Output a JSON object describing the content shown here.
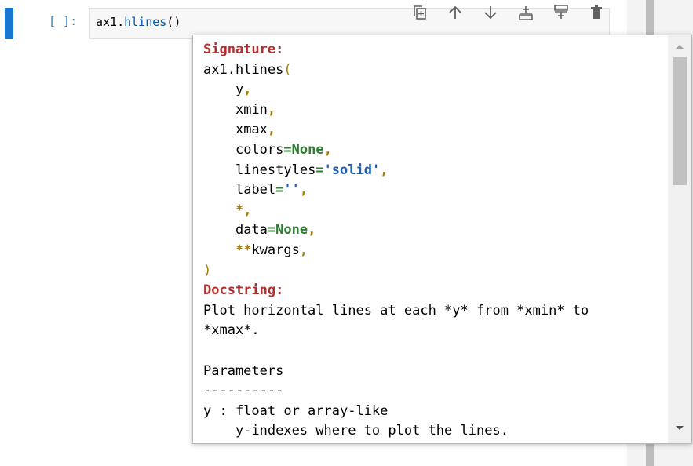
{
  "cell": {
    "prompt": "[ ]:",
    "code_obj": "ax1",
    "code_dot": ".",
    "code_attr": "hlines",
    "code_parens": "()"
  },
  "toolbar": {
    "buttons": [
      "duplicate-cell-icon",
      "move-up-icon",
      "move-down-icon",
      "insert-above-icon",
      "insert-below-icon",
      "delete-icon"
    ]
  },
  "tooltip": {
    "signature_header": "Signature:",
    "call": "ax1.hlines",
    "open_paren": "(",
    "params": {
      "y": "y",
      "xmin": "xmin",
      "xmax": "xmax",
      "colors_name": "colors",
      "colors_default": "None",
      "linestyles_name": "linestyles",
      "linestyles_default": "'solid'",
      "label_name": "label",
      "label_default": "''",
      "star": "*",
      "data_name": "data",
      "data_default": "None",
      "kwargs_stars": "**",
      "kwargs_name": "kwargs"
    },
    "close_paren": ")",
    "docstring_header": "Docstring:",
    "doc_lines": [
      "Plot horizontal lines at each *y* from *xmin* to",
      "*xmax*.",
      "",
      "Parameters",
      "----------",
      "y : float or array-like",
      "    y-indexes where to plot the lines."
    ]
  },
  "colors": {
    "cell_bar": "#1976d2",
    "header_red": "#b22d2d",
    "keyword_green": "#2e7d32",
    "string_blue": "#1e5fb4"
  }
}
